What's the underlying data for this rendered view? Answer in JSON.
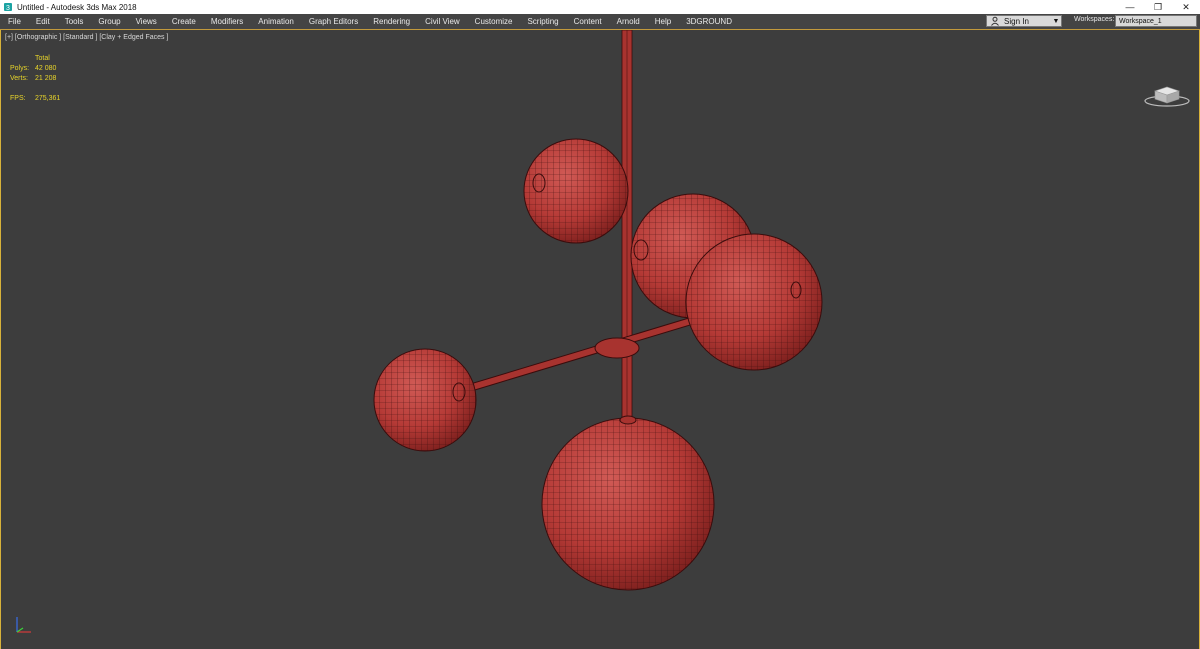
{
  "window": {
    "title": "Untitled - Autodesk 3ds Max 2018",
    "minimize_glyph": "—",
    "maximize_glyph": "❐",
    "close_glyph": "✕"
  },
  "menu": [
    "File",
    "Edit",
    "Tools",
    "Group",
    "Views",
    "Create",
    "Modifiers",
    "Animation",
    "Graph Editors",
    "Rendering",
    "Civil View",
    "Customize",
    "Scripting",
    "Content",
    "Arnold",
    "Help",
    "3DGROUND"
  ],
  "account": {
    "sign_in": "Sign In",
    "caret": "▼"
  },
  "workspaces": {
    "label": "Workspaces:",
    "value": "Workspace_1"
  },
  "viewport": {
    "label": "[+] [Orthographic ] [Standard ] [Clay + Edged Faces ]",
    "stats": {
      "total_label": "Total",
      "polys_label": "Polys:",
      "polys_value": "42 080",
      "verts_label": "Verts:",
      "verts_value": "21 208",
      "fps_label": "FPS:",
      "fps_value": "275,361"
    }
  },
  "colors": {
    "model_fill": "#b53a36",
    "wire": "#3a0c0c",
    "viewport_bg": "#3d3d3d",
    "stats_text": "#e8d52a",
    "active_border": "#d8b23a"
  }
}
